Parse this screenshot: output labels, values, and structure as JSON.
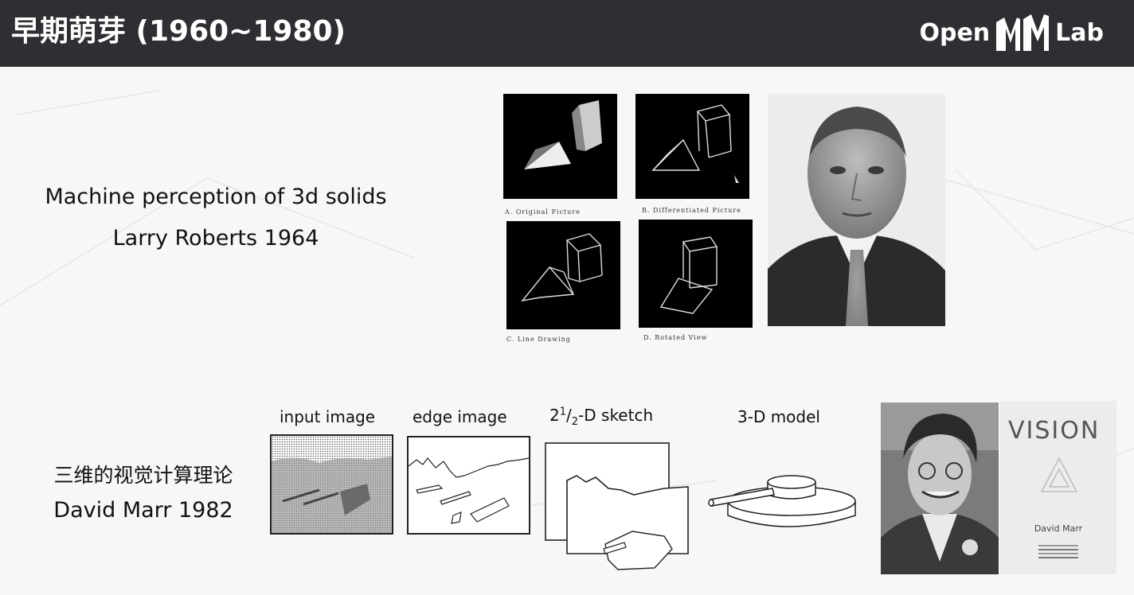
{
  "header": {
    "title": "早期萌芽 (1960~1980)",
    "logo_left": "Open",
    "logo_right": "Lab"
  },
  "roberts": {
    "line1": "Machine perception of 3d solids",
    "line2": "Larry Roberts 1964",
    "captions": [
      "A. Original Picture",
      "B. Differentiated Picture",
      "C. Line Drawing",
      "D. Rotated View"
    ]
  },
  "marr": {
    "line1": "三维的视觉计算理论",
    "line2": "David Marr 1982",
    "stages": [
      "input image",
      "edge image",
      "3-D model"
    ],
    "sketch_prefix": "2",
    "sketch_sup": "1",
    "sketch_sub": "2",
    "sketch_suffix": "-D sketch",
    "book_title": "VISION",
    "book_author": "David Marr"
  },
  "colors": {
    "header_bg": "#2d2f33",
    "text": "#111111"
  }
}
